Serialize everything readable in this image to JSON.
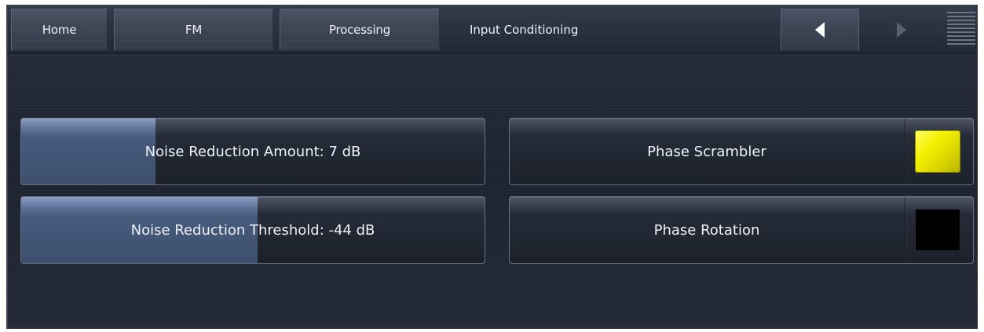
{
  "nav": {
    "home_label": "Home",
    "fm_label": "FM",
    "processing_label": "Processing",
    "page_title": "Input Conditioning"
  },
  "controls": {
    "noise_reduction_amount": {
      "label": "Noise Reduction Amount: 7 dB",
      "level": 0.29
    },
    "noise_reduction_threshold": {
      "label": "Noise Reduction Threshold: -44 dB",
      "level": 0.51
    },
    "phase_scrambler": {
      "label": "Phase Scrambler",
      "state": "on"
    },
    "phase_rotation": {
      "label": "Phase Rotation",
      "state": "off"
    }
  },
  "icons": {
    "back": "triangle-left-icon",
    "forward": "triangle-right-icon",
    "menu": "menu-lines-icon"
  },
  "colors": {
    "indicator_on": "#f2ef00",
    "indicator_off": "#000000",
    "slider_fill": "#566c92"
  }
}
